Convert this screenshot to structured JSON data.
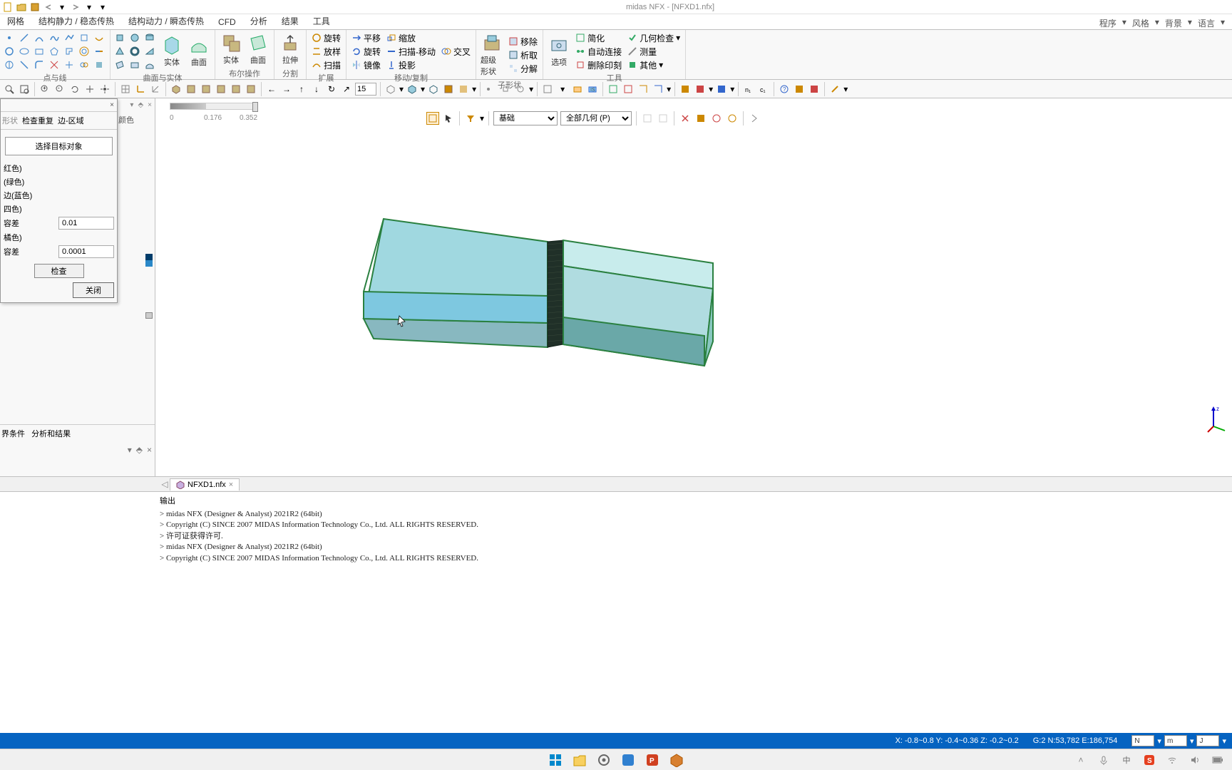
{
  "title": "midas NFX - [NFXD1.nfx]",
  "qat_icons": [
    "new-file-icon",
    "open-file-icon",
    "save-icon",
    "undo-icon",
    "redo-icon",
    "divider-icon"
  ],
  "ribbon_tabs": [
    "网格",
    "结构静力 / 稳态传热",
    "结构动力 / 瞬态传热",
    "CFD",
    "分析",
    "结果",
    "工具"
  ],
  "ribbon_right": [
    "程序",
    "风格",
    "背景",
    "语言"
  ],
  "ribbon_groups": {
    "g1_label": "点与线",
    "g2_label": "曲面与实体",
    "g2_btns": [
      "实体",
      "曲面"
    ],
    "g3_label": "布尔操作",
    "g3_btns": [
      "实体",
      "曲面"
    ],
    "g4_label": "分割",
    "g4_btn": "拉伸",
    "g5_label": "扩展",
    "g5_items": [
      "旋转",
      "放样",
      "扫描"
    ],
    "g6_label": "移动/复制",
    "g6_items": [
      "平移",
      "旋转",
      "镜像",
      "缩放",
      "扫描-移动",
      "投影",
      "交叉"
    ],
    "g7_label": "子形状",
    "g7_btn": "超级形状",
    "g7_items": [
      "移除",
      "析取",
      "分解"
    ],
    "g8_label": "工具",
    "g8_btn": "选项",
    "g8_items": [
      "简化",
      "自动连接",
      "删除印刻",
      "几何检查",
      "测量",
      "其他"
    ]
  },
  "toolbar2": {
    "input_val": "15"
  },
  "dialog": {
    "tabs": [
      "形状",
      "检查重复",
      "边-区域"
    ],
    "select_label": "选择目标对象",
    "rows": [
      "红色)",
      "(绿色)",
      "边(蓝色)",
      "四色)",
      "容差",
      "橘色)",
      "容差"
    ],
    "val1": "0.01",
    "val2": "0.0001",
    "btn_check": "检查",
    "btn_close": "关闭",
    "side_label": "颜色",
    "panel_tabs": [
      "界条件",
      "分析和结果"
    ]
  },
  "ruler_ticks": [
    "0",
    "0.176",
    "0.352"
  ],
  "viewport": {
    "sel1": "基础",
    "sel2": "全部几何 (P)"
  },
  "doc_tab": {
    "name": "NFXD1.nfx"
  },
  "output": {
    "title": "输出",
    "lines": [
      ">  midas NFX (Designer & Analyst) 2021R2 (64bit)",
      ">  Copyright (C) SINCE 2007 MIDAS Information Technology Co., Ltd. ALL RIGHTS RESERVED.",
      ">  许可证获得许可.",
      ">  midas NFX (Designer & Analyst) 2021R2 (64bit)",
      ">  Copyright (C) SINCE 2007 MIDAS Information Technology Co., Ltd. ALL RIGHTS RESERVED."
    ]
  },
  "status": {
    "coords": "X: -0.8~0.8 Y: -0.4~0.36 Z: -0.2~0.2",
    "info": "G:2  N:53,782  E:186,754",
    "boxes": [
      "N",
      "m",
      "J"
    ]
  }
}
